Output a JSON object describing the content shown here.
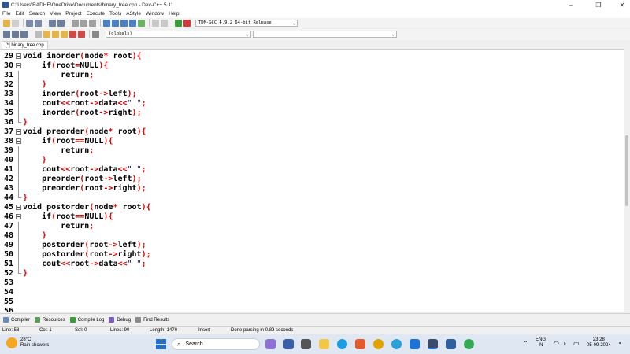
{
  "window": {
    "title": "C:\\Users\\RADHE\\OneDrive\\Documents\\binary_tree.cpp - Dev-C++ 5.11",
    "minimize": "–",
    "maximize": "❐",
    "close": "✕"
  },
  "menu": [
    "File",
    "Edit",
    "Search",
    "View",
    "Project",
    "Execute",
    "Tools",
    "AStyle",
    "Window",
    "Help"
  ],
  "toolbar": {
    "compiler": "TDM-GCC 4.9.2 64-bit Release",
    "scope": "(globals)",
    "member": ""
  },
  "tabs": [
    {
      "label": "[*] binary_tree.cpp"
    }
  ],
  "editor": {
    "lines": [
      {
        "num": "29",
        "text": "void inorder(node* root){",
        "fold": "box"
      },
      {
        "num": "30",
        "text": "    if(root=NULL){",
        "fold": "box"
      },
      {
        "num": "31",
        "text": "        return;",
        "fold": "line"
      },
      {
        "num": "32",
        "text": "    }",
        "fold": "line"
      },
      {
        "num": "33",
        "text": "    inorder(root->left);",
        "fold": "line"
      },
      {
        "num": "34",
        "text": "    cout<<root->data<<\" \";",
        "fold": "line"
      },
      {
        "num": "35",
        "text": "    inorder(root->right);",
        "fold": "line"
      },
      {
        "num": "36",
        "text": "}",
        "fold": "end"
      },
      {
        "num": "37",
        "text": "void preorder(node* root){",
        "fold": "box"
      },
      {
        "num": "38",
        "text": "    if(root==NULL){",
        "fold": "box"
      },
      {
        "num": "39",
        "text": "        return;",
        "fold": "line"
      },
      {
        "num": "40",
        "text": "    }",
        "fold": "line"
      },
      {
        "num": "41",
        "text": "    cout<<root->data<<\" \";",
        "fold": "line"
      },
      {
        "num": "42",
        "text": "    preorder(root->left);",
        "fold": "line"
      },
      {
        "num": "43",
        "text": "    preorder(root->right);",
        "fold": "line"
      },
      {
        "num": "44",
        "text": "}",
        "fold": "end"
      },
      {
        "num": "45",
        "text": "void postorder(node* root){",
        "fold": "box"
      },
      {
        "num": "46",
        "text": "    if(root==NULL){",
        "fold": "box"
      },
      {
        "num": "47",
        "text": "        return;",
        "fold": "line"
      },
      {
        "num": "48",
        "text": "    }",
        "fold": "line"
      },
      {
        "num": "49",
        "text": "    postorder(root->left);",
        "fold": "line"
      },
      {
        "num": "50",
        "text": "    postorder(root->right);",
        "fold": "line"
      },
      {
        "num": "51",
        "text": "    cout<<root->data<<\" \";",
        "fold": "line"
      },
      {
        "num": "52",
        "text": "}",
        "fold": "end"
      },
      {
        "num": "53",
        "text": "",
        "fold": ""
      },
      {
        "num": "54",
        "text": "",
        "fold": ""
      },
      {
        "num": "55",
        "text": "",
        "fold": ""
      },
      {
        "num": "56",
        "text": "",
        "fold": ""
      }
    ]
  },
  "panel_tabs": [
    "Compiler",
    "Resources",
    "Compile Log",
    "Debug",
    "Find Results"
  ],
  "status": {
    "line": "Line:    58",
    "col": "Col:    1",
    "sel": "Sel:    0",
    "lines": "Lines:    90",
    "length": "Length:  1470",
    "mode": "Insert",
    "message": "Done parsing in 0.89 seconds"
  },
  "taskbar": {
    "temp": "28°C",
    "weather": "Rain showers",
    "search_placeholder": "Search",
    "lang1": "ENG",
    "lang2": "IN",
    "time": "23:28",
    "date": "05-09-2024"
  },
  "colors": {
    "keyword": "#000000",
    "symbol": "#e00000",
    "string": "#000080",
    "accent": "#1e6fd9"
  }
}
